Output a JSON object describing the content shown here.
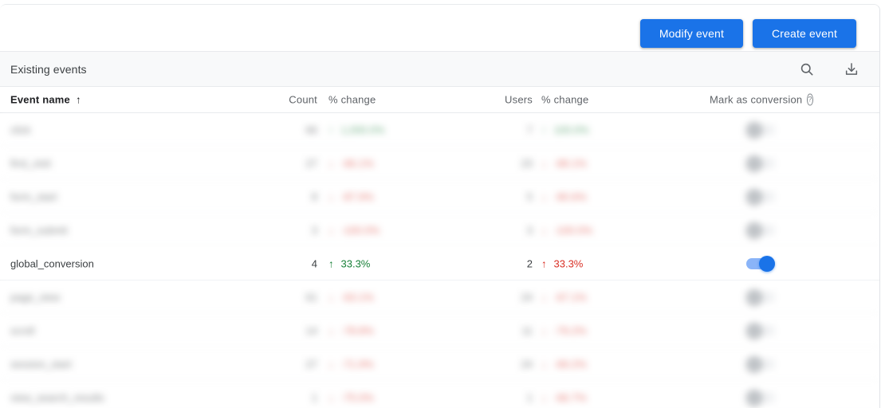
{
  "toolbar": {
    "modify_label": "Modify event",
    "create_label": "Create event",
    "accent_color": "#1a73e8"
  },
  "section": {
    "title": "Existing events",
    "search_icon": "search-icon",
    "download_icon": "download-icon"
  },
  "table": {
    "columns": {
      "name": "Event name",
      "sort_arrow": "↑",
      "count": "Count",
      "count_change": "% change",
      "users": "Users",
      "users_change": "% change",
      "conversion": "Mark as conversion",
      "help_glyph": "?"
    },
    "rows": [
      {
        "name": "click",
        "count": "66",
        "count_arrow": "↑",
        "count_change": "1,000.0%",
        "count_dir": "up-green",
        "users": "7",
        "users_arrow": "↑",
        "users_change": "100.0%",
        "users_dir": "up-green",
        "conversion": false,
        "blurred": true
      },
      {
        "name": "first_visit",
        "count": "27",
        "count_arrow": "↓",
        "count_change": "-66.1%",
        "count_dir": "up-red",
        "users": "23",
        "users_arrow": "↓",
        "users_change": "-68.1%",
        "users_dir": "up-red",
        "conversion": false,
        "blurred": true
      },
      {
        "name": "form_start",
        "count": "8",
        "count_arrow": "↓",
        "count_change": "-87.9%",
        "count_dir": "up-red",
        "users": "5",
        "users_arrow": "↓",
        "users_change": "-90.6%",
        "users_dir": "up-red",
        "conversion": false,
        "blurred": true
      },
      {
        "name": "form_submit",
        "count": "3",
        "count_arrow": "↓",
        "count_change": "-100.0%",
        "count_dir": "up-red",
        "users": "3",
        "users_arrow": "↓",
        "users_change": "-100.0%",
        "users_dir": "up-red",
        "conversion": false,
        "blurred": true
      },
      {
        "name": "global_conversion",
        "count": "4",
        "count_arrow": "↑",
        "count_change": "33.3%",
        "count_dir": "up-green",
        "users": "2",
        "users_arrow": "↑",
        "users_change": "33.3%",
        "users_dir": "up-red",
        "conversion": true,
        "blurred": false
      },
      {
        "name": "page_view",
        "count": "61",
        "count_arrow": "↓",
        "count_change": "-63.1%",
        "count_dir": "up-red",
        "users": "24",
        "users_arrow": "↓",
        "users_change": "-67.1%",
        "users_dir": "up-red",
        "conversion": false,
        "blurred": true
      },
      {
        "name": "scroll",
        "count": "14",
        "count_arrow": "↓",
        "count_change": "-78.8%",
        "count_dir": "up-red",
        "users": "11",
        "users_arrow": "↓",
        "users_change": "-79.2%",
        "users_dir": "up-red",
        "conversion": false,
        "blurred": true
      },
      {
        "name": "session_start",
        "count": "27",
        "count_arrow": "↓",
        "count_change": "-71.9%",
        "count_dir": "up-red",
        "users": "24",
        "users_arrow": "↓",
        "users_change": "-69.2%",
        "users_dir": "up-red",
        "conversion": false,
        "blurred": true
      },
      {
        "name": "view_search_results",
        "count": "1",
        "count_arrow": "↓",
        "count_change": "-75.0%",
        "count_dir": "up-red",
        "users": "1",
        "users_arrow": "↓",
        "users_change": "-66.7%",
        "users_dir": "up-red",
        "conversion": false,
        "blurred": true
      }
    ]
  }
}
